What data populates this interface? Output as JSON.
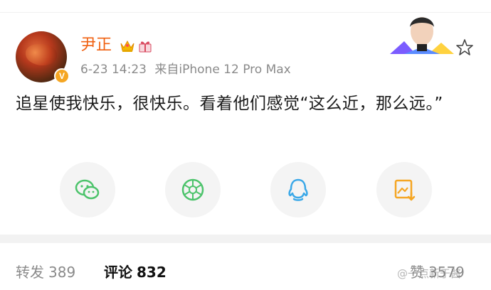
{
  "user": {
    "name": "尹正",
    "time": "6-23 14:23",
    "source": "来自iPhone 12 Pro Max",
    "verified_badge": "V"
  },
  "post": {
    "text": "追星使我快乐，很快乐。看着他们感觉“这么近，那么远。”"
  },
  "share": [
    {
      "icon": "wechat-icon",
      "color": "#4cc36b"
    },
    {
      "icon": "moments-icon",
      "color": "#4cc36b"
    },
    {
      "icon": "qq-icon",
      "color": "#3aa8e8"
    },
    {
      "icon": "save-image-icon",
      "color": "#f5a623"
    }
  ],
  "stats": {
    "repost_label": "转发",
    "repost_count": "389",
    "comment_label": "评论",
    "comment_count": "832",
    "like_label": "赞",
    "like_count": "3579"
  },
  "watermark": "@一点新于酱",
  "colors": {
    "name": "#f06010",
    "meta": "#8a8a8a",
    "badge": "#f5a623"
  }
}
